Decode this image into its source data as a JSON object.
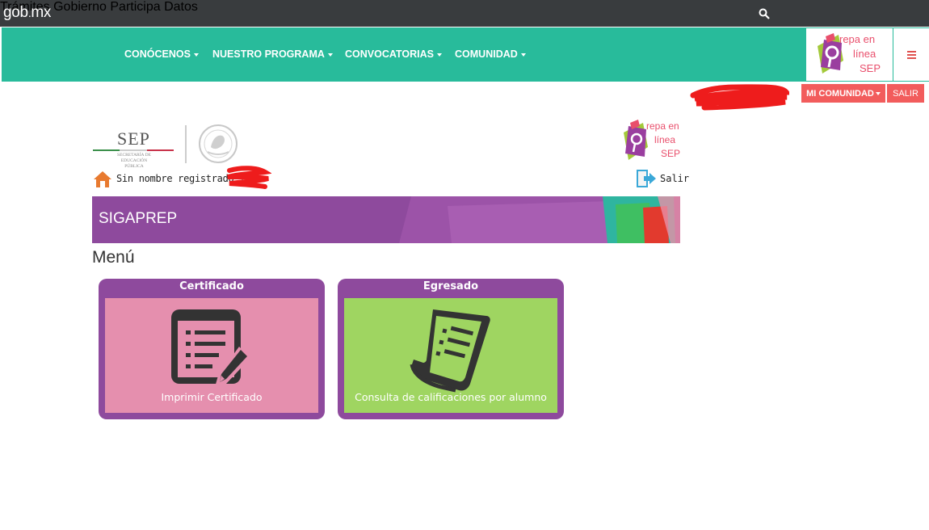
{
  "gob": {
    "logo_main": "gob",
    "logo_dot": ".",
    "logo_tld": "mx",
    "nav": [
      "Trámites",
      "Gobierno",
      "Participa",
      "Datos"
    ]
  },
  "main_nav": {
    "items": [
      "CONÓCENOS",
      "NUESTRO PROGRAMA",
      "CONVOCATORIAS",
      "COMUNIDAD"
    ]
  },
  "prepa_logo": {
    "line1": "repa en",
    "line2": "línea",
    "line3": "SEP"
  },
  "community": {
    "mi_comunidad_label": "MI COMUNIDAD",
    "salir_label": "SALIR"
  },
  "sep": {
    "title": "SEP",
    "subtitle": "SECRETARÍA DE EDUCACIÓN PÚBLICA"
  },
  "user": {
    "name_text": "Sin nombre registrado |",
    "logout_label": "Salir"
  },
  "banner": {
    "title": "SIGAPREP"
  },
  "menu": {
    "heading": "Menú",
    "cards": [
      {
        "title": "Certificado",
        "label": "Imprimir Certificado",
        "bg": "#e58fae"
      },
      {
        "title": "Egresado",
        "label": "Consulta de calificaciones por alumno",
        "bg": "#9fd561"
      }
    ]
  },
  "colors": {
    "gob_bar": "#393c3e",
    "nav_green": "#28bb9b",
    "purple": "#8e4a9d",
    "red_button": "#f25c5c"
  }
}
